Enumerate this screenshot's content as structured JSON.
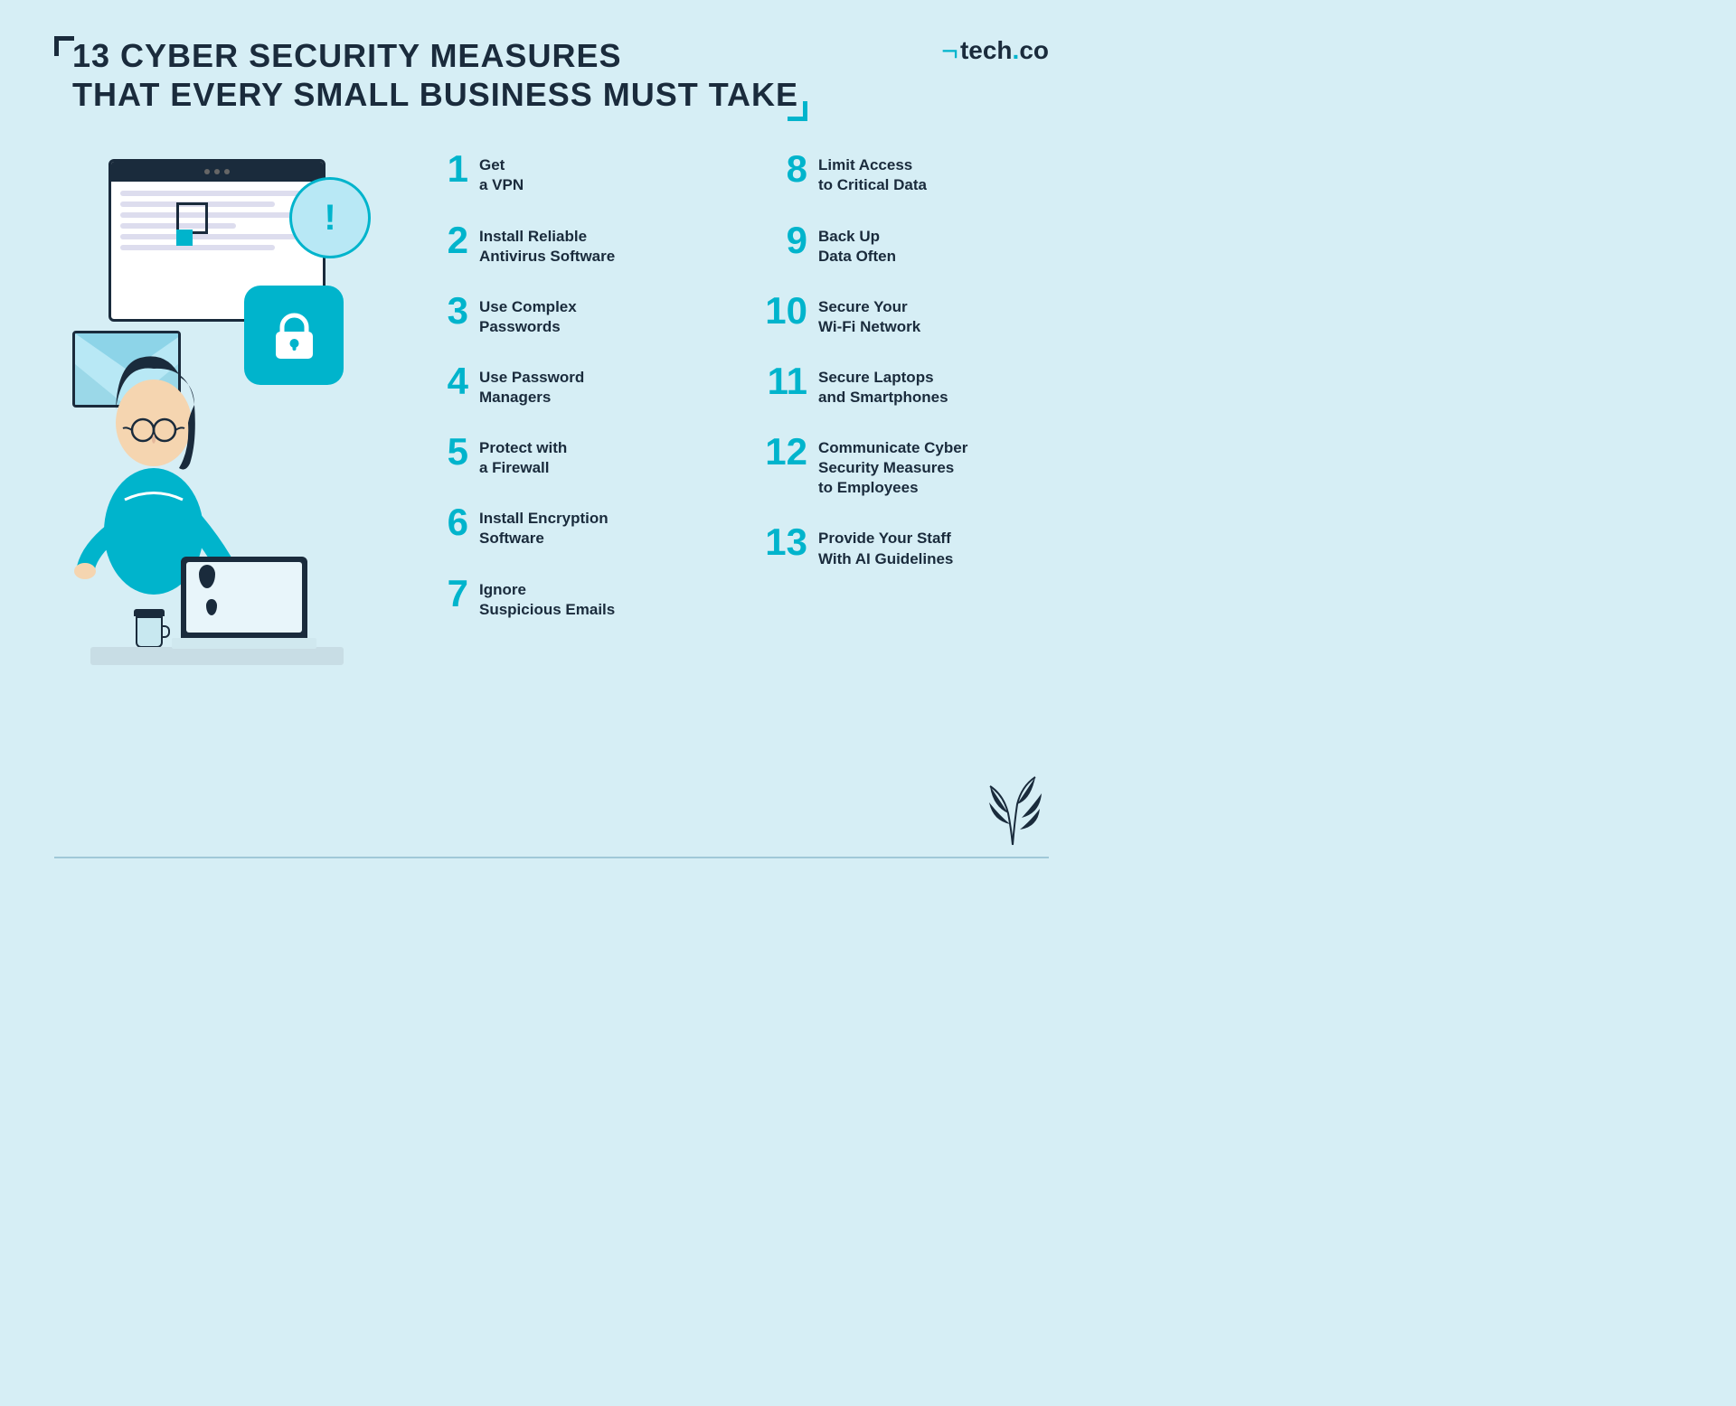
{
  "logo": {
    "bracket": "⌐",
    "text": "tech",
    "dot": ".",
    "suffix": "co"
  },
  "title": {
    "line1": "13 CYBER SECURITY MEASURES",
    "line2": "THAT EVERY SMALL BUSINESS MUST TAKE"
  },
  "left_list": [
    {
      "number": "1",
      "text": "Get\na VPN"
    },
    {
      "number": "2",
      "text": "Install Reliable\nAntivirus Software"
    },
    {
      "number": "3",
      "text": "Use Complex\nPasswords"
    },
    {
      "number": "4",
      "text": "Use Password\nManagers"
    },
    {
      "number": "5",
      "text": "Protect with\na Firewall"
    },
    {
      "number": "6",
      "text": "Install Encryption\nSoftware"
    },
    {
      "number": "7",
      "text": "Ignore\nSuspicious Emails"
    }
  ],
  "right_list": [
    {
      "number": "8",
      "text": "Limit Access\nto Critical Data"
    },
    {
      "number": "9",
      "text": "Back Up\nData Often"
    },
    {
      "number": "10",
      "text": "Secure Your\nWi-Fi Network"
    },
    {
      "number": "11",
      "text": "Secure Laptops\nand Smartphones"
    },
    {
      "number": "12",
      "text": "Communicate Cyber\nSecurity Measures\nto Employees"
    },
    {
      "number": "13",
      "text": "Provide Your Staff\nWith AI Guidelines"
    }
  ],
  "colors": {
    "teal": "#00b4cc",
    "dark": "#1a2b3c",
    "bg": "#d6eef5",
    "light_blue": "#b8e8f5"
  }
}
